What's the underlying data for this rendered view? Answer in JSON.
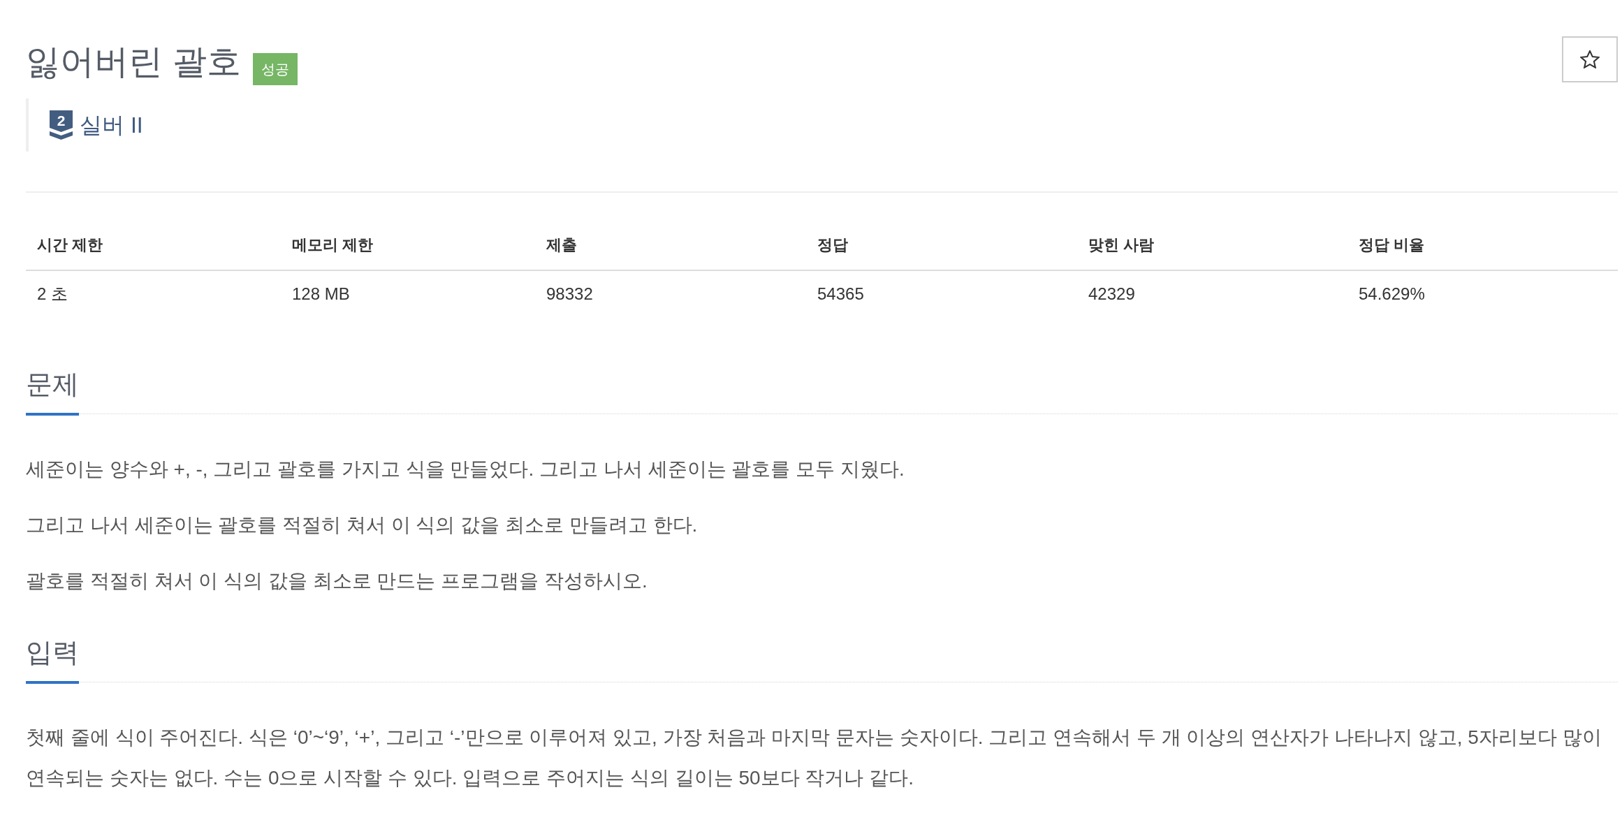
{
  "problem": {
    "title": "잃어버린 괄호",
    "result_badge": "성공",
    "starred": false,
    "tier": {
      "level": "2",
      "label": "실버 II"
    }
  },
  "info_table": {
    "columns": [
      "시간 제한",
      "메모리 제한",
      "제출",
      "정답",
      "맞힌 사람",
      "정답 비율"
    ],
    "rows": [
      [
        "2 초",
        "128 MB",
        "98332",
        "54365",
        "42329",
        "54.629%"
      ]
    ]
  },
  "sections": [
    {
      "heading": "문제",
      "paragraphs": [
        "세준이는 양수와 +, -, 그리고 괄호를 가지고 식을 만들었다. 그리고 나서 세준이는 괄호를 모두 지웠다.",
        "그리고 나서 세준이는 괄호를 적절히 쳐서 이 식의 값을 최소로 만들려고 한다.",
        "괄호를 적절히 쳐서 이 식의 값을 최소로 만드는 프로그램을 작성하시오."
      ]
    },
    {
      "heading": "입력",
      "paragraphs": [
        "첫째 줄에 식이 주어진다. 식은 ‘0’~‘9’, ‘+’, 그리고 ‘-’만으로 이루어져 있고, 가장 처음과 마지막 문자는 숫자이다. 그리고 연속해서 두 개 이상의 연산자가 나타나지 않고, 5자리보다 많이 연속되는 숫자는 없다. 수는 0으로 시작할 수 있다. 입력으로 주어지는 식의 길이는 50보다 작거나 같다."
      ]
    }
  ]
}
